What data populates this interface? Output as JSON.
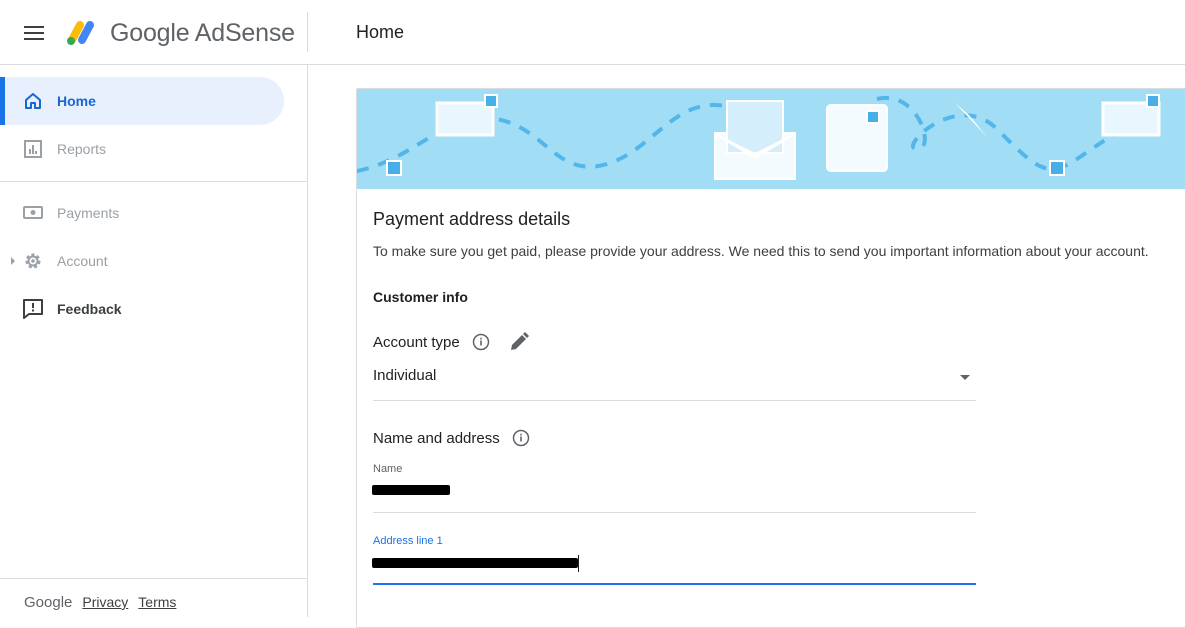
{
  "app": {
    "logo_text": "Google AdSense",
    "page_title": "Home",
    "brand_colors": {
      "yellow": "#fbbc04",
      "blue": "#4285f4",
      "green": "#34a853",
      "accent": "#1a73e8"
    }
  },
  "header": {
    "menu_icon": "hamburger-menu-icon"
  },
  "sidebar": {
    "items": [
      {
        "label": "Home",
        "icon": "home-icon",
        "state": "active"
      },
      {
        "label": "Reports",
        "icon": "bar-chart-icon",
        "state": "disabled"
      },
      {
        "label": "Payments",
        "icon": "payments-icon",
        "state": "disabled"
      },
      {
        "label": "Account",
        "icon": "gear-icon",
        "state": "disabled"
      },
      {
        "label": "Feedback",
        "icon": "feedback-icon",
        "state": "normal"
      }
    ],
    "footer": {
      "brand": "Google",
      "privacy": "Privacy",
      "terms": "Terms"
    }
  },
  "card": {
    "title": "Payment address details",
    "description": "To make sure you get paid, please provide your address. We need this to send you important information about your account.",
    "customer_info_title": "Customer info",
    "account_type": {
      "label": "Account type",
      "value": "Individual"
    },
    "name_address_title": "Name and address",
    "name_field": {
      "label": "Name",
      "value": ""
    },
    "address_line1": {
      "label": "Address line 1",
      "value": ""
    }
  }
}
